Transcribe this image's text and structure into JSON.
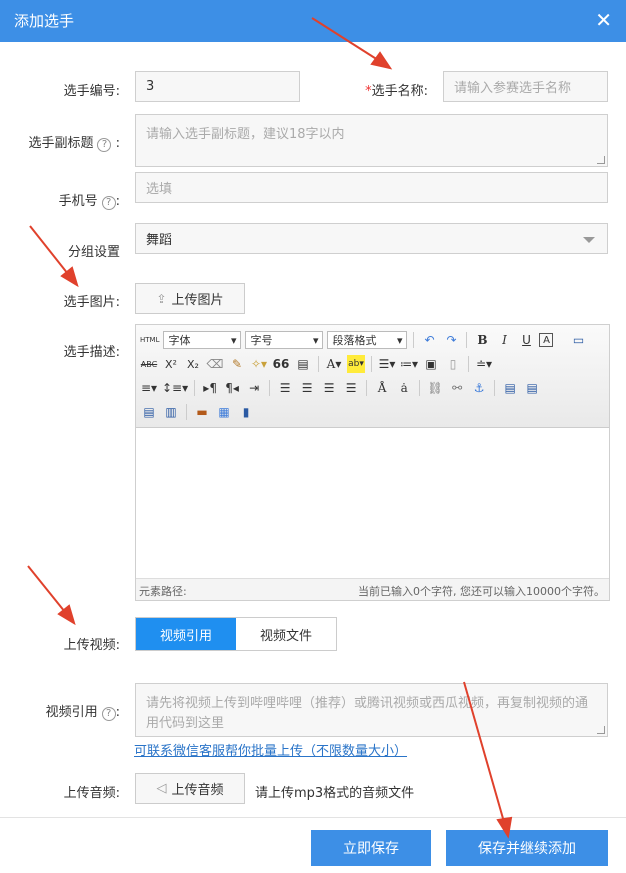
{
  "dialog": {
    "title": "添加选手",
    "close_icon": "close-icon"
  },
  "form": {
    "number_label": "选手编号:",
    "number_value": "3",
    "name_required": "*",
    "name_label": "选手名称:",
    "name_placeholder": "请输入参赛选手名称",
    "subtitle_label": "选手副标题",
    "subtitle_placeholder": "请输入选手副标题，建议18字以内",
    "phone_label": "手机号",
    "phone_placeholder": "选填",
    "group_label": "分组设置",
    "group_value": "舞蹈",
    "image_label": "选手图片:",
    "image_button": "上传图片",
    "desc_label": "选手描述:",
    "video_label": "上传视频:",
    "video_tabs": [
      "视频引用",
      "视频文件"
    ],
    "video_ref_label": "视频引用",
    "video_ref_placeholder": "请先将视频上传到哔哩哔哩（推荐）或腾讯视频或西瓜视频，再复制视频的通用代码到这里",
    "batch_link": "可联系微信客服帮你批量上传（不限数量大小）",
    "audio_label": "上传音频:",
    "audio_button": "上传音频",
    "audio_note": "请上传mp3格式的音频文件",
    "help_glyph": "?",
    "colon": ":"
  },
  "editor": {
    "html_btn": "HTML",
    "font_combo": "字体",
    "size_combo": "字号",
    "para_combo": "段落格式",
    "bold": "B",
    "italic": "I",
    "underline": "U",
    "strike": "ABC",
    "sup": "X²",
    "sub": "X₂",
    "quote": "66",
    "font_color": "A",
    "status_path": "元素路径:",
    "status_count": "当前已输入0个字符, 您还可以输入10000个字符。"
  },
  "footer": {
    "save": "立即保存",
    "save_continue": "保存并继续添加"
  },
  "colors": {
    "primary": "#3d8fe6",
    "tab_active": "#1f8ff0",
    "arrow": "#e0412c"
  }
}
